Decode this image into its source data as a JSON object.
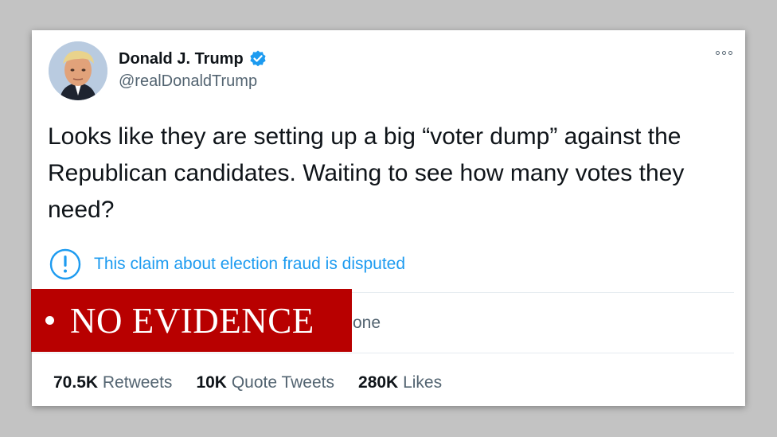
{
  "tweet": {
    "author_name": "Donald J. Trump",
    "handle": "@realDonaldTrump",
    "text": "Looks like they are setting up a big “voter dump” against the Republican candidates. Waiting to see how many votes they need?",
    "notice": "This claim about election fraud is disputed",
    "context_fragment": "one",
    "stats": [
      {
        "value": "70.5K",
        "label": "Retweets"
      },
      {
        "value": "10K",
        "label": "Quote Tweets"
      },
      {
        "value": "280K",
        "label": "Likes"
      }
    ]
  },
  "banner": {
    "label": "NO EVIDENCE",
    "color": "#b80000"
  },
  "colors": {
    "link_blue": "#1d9bf0",
    "text": "#0f1419",
    "muted": "#536471"
  },
  "icons": {
    "verified": "verified-badge-icon",
    "notice": "info-circle-icon",
    "more": "more-options-icon"
  }
}
